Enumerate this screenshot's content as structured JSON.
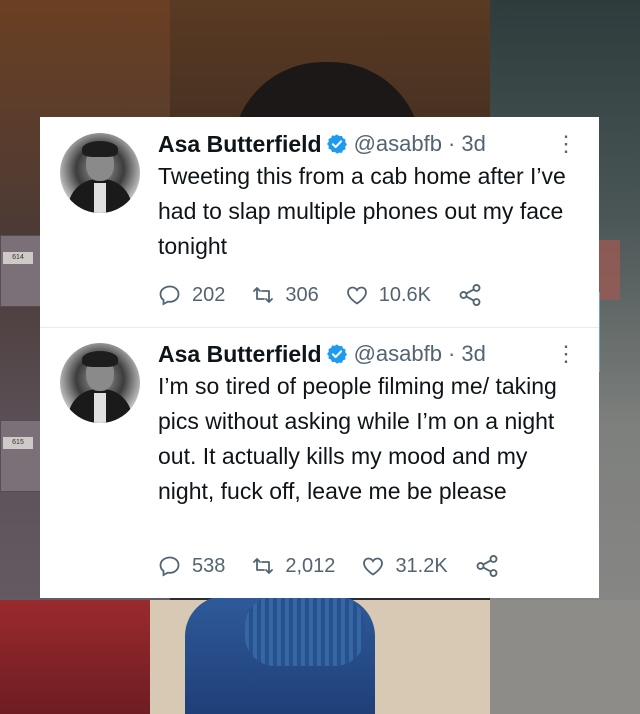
{
  "tweets": [
    {
      "name": "Asa Butterfield",
      "handle": "@asabfb",
      "time": "· 3d",
      "text": "Tweeting this from a cab home after I’ve had to slap multiple phones out my face tonight",
      "replies": "202",
      "retweets": "306",
      "likes": "10.6K"
    },
    {
      "name": "Asa Butterfield",
      "handle": "@asabfb",
      "time": "· 3d",
      "text": "I’m so tired of people filming me/ taking pics without asking while I’m on a night out. It actually kills my mood and my night, fuck off, leave me be please",
      "replies": "538",
      "retweets": "2,012",
      "likes": "31.2K"
    }
  ],
  "background": {
    "locker_tags": [
      "614",
      "615"
    ]
  },
  "colors": {
    "verified": "#1d9bf0",
    "text": "#0f1419",
    "secondary": "#536471"
  },
  "icons": [
    "verified-badge-icon",
    "more-icon",
    "reply-icon",
    "retweet-icon",
    "like-icon",
    "share-icon"
  ]
}
